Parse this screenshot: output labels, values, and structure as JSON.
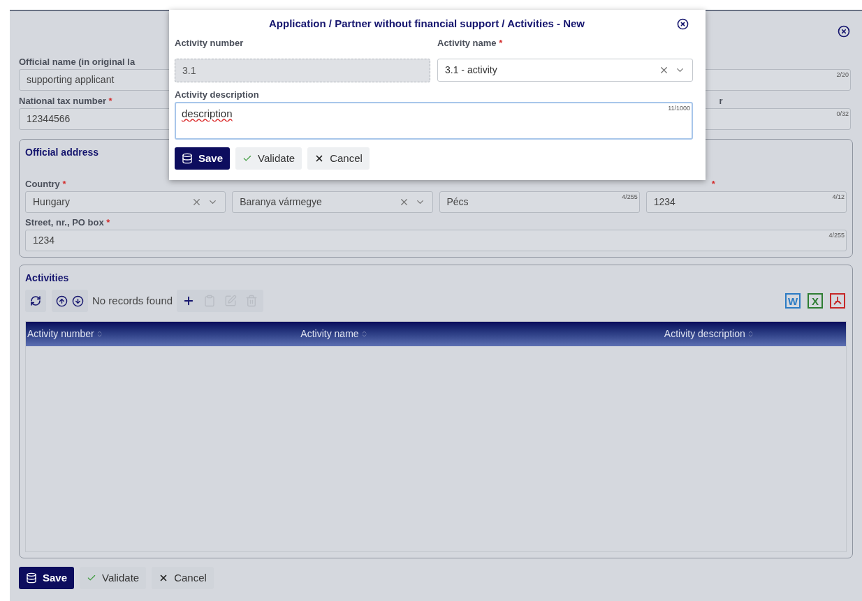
{
  "form": {
    "rows": [
      [
        {
          "label": "Official name (in original la",
          "value": "supporting applicant"
        },
        {
          "counter": "2/20"
        }
      ],
      [
        {
          "label": "National tax number",
          "mark": "*",
          "value": "12344566"
        },
        {
          "label": "r",
          "counter": "0/32"
        }
      ]
    ]
  },
  "address": {
    "title": "Official address",
    "fields": [
      {
        "kind": "select",
        "label": "Country",
        "mark": "*",
        "value": "Hungary"
      },
      {
        "kind": "select",
        "value": "Baranya vármegye"
      },
      {
        "kind": "text",
        "value": "Pécs",
        "counter": "4/255"
      },
      {
        "kind": "text",
        "mark": "*",
        "value": "1234",
        "counter": "4/12"
      }
    ],
    "street": {
      "label": "Street, nr., PO box",
      "mark": "*",
      "value": "1234",
      "counter": "4/255"
    }
  },
  "activities": {
    "title": "Activities",
    "status": "No records found",
    "tools": [
      {
        "kind": "add",
        "disabled": false
      },
      {
        "kind": "copy",
        "disabled": true
      },
      {
        "kind": "edit",
        "disabled": true
      },
      {
        "kind": "delete",
        "disabled": true
      }
    ],
    "exports": [
      {
        "kind": "word",
        "label": "W",
        "color": "#2b7bc4"
      },
      {
        "kind": "excel",
        "label": "X",
        "color": "#2e7d32"
      },
      {
        "kind": "pdf",
        "color": "#c62828"
      }
    ],
    "columns": [
      "Activity number",
      "Activity name",
      "Activity description"
    ]
  },
  "buttons": [
    {
      "kind": "save",
      "label": "Save"
    },
    {
      "kind": "validate",
      "label": "Validate"
    },
    {
      "kind": "cancel",
      "label": "Cancel"
    }
  ],
  "dialog": {
    "title": "Application / Partner without financial support / Activities - New",
    "number": {
      "label": "Activity number",
      "value": "3.1",
      "disabled": true
    },
    "name": {
      "label": "Activity name",
      "mark": "*",
      "value": "3.1 - activity"
    },
    "description": {
      "label": "Activity description",
      "value": "description",
      "counter": "11/1000",
      "focused": true
    },
    "buttons": [
      {
        "kind": "save",
        "label": "Save"
      },
      {
        "kind": "validate",
        "label": "Validate"
      },
      {
        "kind": "cancel",
        "label": "Cancel"
      }
    ]
  }
}
